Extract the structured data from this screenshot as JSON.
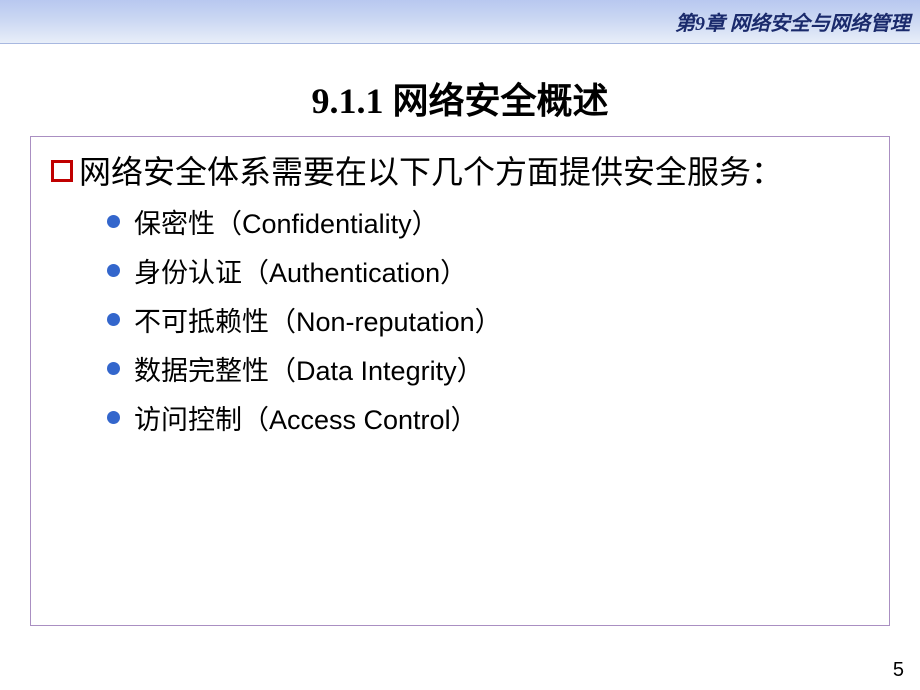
{
  "header": {
    "chapter_label": "第9章 网络安全与网络管理"
  },
  "title": "9.1.1  网络安全概述",
  "main_point": "网络安全体系需要在以下几个方面提供安全服务：",
  "services": [
    {
      "cn": "保密性",
      "en": "Confidentiality"
    },
    {
      "cn": "身份认证",
      "en": "Authentication"
    },
    {
      "cn": "不可抵赖性",
      "en": "Non-reputation"
    },
    {
      "cn": "数据完整性",
      "en": "Data Integrity"
    },
    {
      "cn": "访问控制",
      "en": "Access Control"
    }
  ],
  "page_number": "5"
}
